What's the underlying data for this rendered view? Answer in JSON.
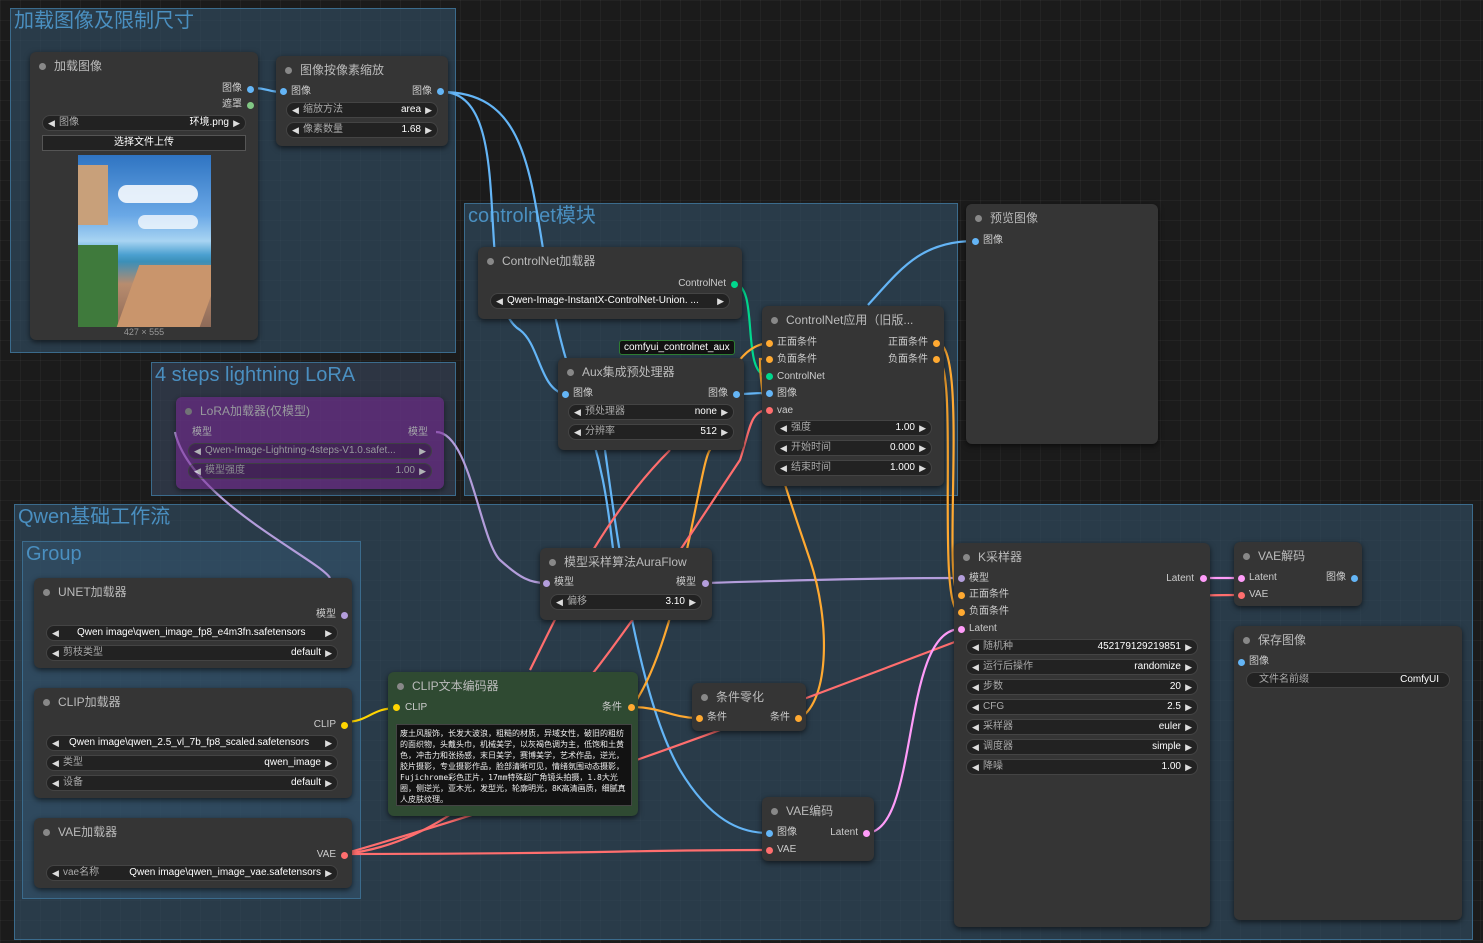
{
  "groups": {
    "load": "加载图像及限制尺寸",
    "controlnet": "controlnet模块",
    "lora": "4 steps lightning LoRA",
    "qwen": "Qwen基础工作流",
    "group": "Group"
  },
  "load_image": {
    "title": "加载图像",
    "out_image": "图像",
    "out_mask": "遮罩",
    "image_label": "图像",
    "image_value": "环境.png",
    "upload_button": "选择文件上传",
    "dimensions": "427 × 555"
  },
  "scale": {
    "title": "图像按像素缩放",
    "in_image": "图像",
    "out_image": "图像",
    "method_label": "缩放方法",
    "method_value": "area",
    "mp_label": "像素数量",
    "mp_value": "1.68"
  },
  "preview": {
    "title": "预览图像",
    "in_image": "图像"
  },
  "cn_loader": {
    "title": "ControlNet加载器",
    "out": "ControlNet",
    "model": "Qwen-Image-InstantX-ControlNet-Union. ..."
  },
  "cn_apply": {
    "title": "ControlNet应用（旧版...",
    "in_pos": "正面条件",
    "in_neg": "负面条件",
    "in_cn": "ControlNet",
    "in_image": "图像",
    "in_vae": "vae",
    "out_pos": "正面条件",
    "out_neg": "负面条件",
    "strength_label": "强度",
    "strength_value": "1.00",
    "start_label": "开始时间",
    "start_value": "0.000",
    "end_label": "结束时间",
    "end_value": "1.000"
  },
  "aux_tag": "comfyui_controlnet_aux",
  "aux": {
    "title": "Aux集成预处理器",
    "in_image": "图像",
    "out_image": "图像",
    "pre_label": "预处理器",
    "pre_value": "none",
    "res_label": "分辨率",
    "res_value": "512"
  },
  "lora": {
    "title": "LoRA加载器(仅模型)",
    "in_model": "模型",
    "out_model": "模型",
    "name": "Qwen-Image-Lightning-4steps-V1.0.safet...",
    "strength_label": "模型强度",
    "strength_value": "1.00"
  },
  "unet": {
    "title": "UNET加载器",
    "out": "模型",
    "name": "Qwen image\\qwen_image_fp8_e4m3fn.safetensors",
    "dtype_label": "剪枝类型",
    "dtype_value": "default"
  },
  "clip_loader": {
    "title": "CLIP加载器",
    "out": "CLIP",
    "name": "Qwen image\\qwen_2.5_vl_7b_fp8_scaled.safetensors",
    "type_label": "类型",
    "type_value": "qwen_image",
    "device_label": "设备",
    "device_value": "default"
  },
  "vae_loader": {
    "title": "VAE加载器",
    "out": "VAE",
    "name_label": "vae名称",
    "name_value": "Qwen image\\qwen_image_vae.safetensors"
  },
  "aura": {
    "title": "模型采样算法AuraFlow",
    "in_model": "模型",
    "out_model": "模型",
    "shift_label": "偏移",
    "shift_value": "3.10"
  },
  "clip_text": {
    "title": "CLIP文本编码器",
    "in_clip": "CLIP",
    "out_cond": "条件",
    "prompt": "废土风服饰，长发大波浪，粗糙的材质，异域女性，破旧的粗纺的面织物，头戴头巾，机械美学，以灰褐色调为主，低饱和土黄色，冲击力和张扬感，末日美学，赛博美学，艺术作品，逆光，胶片摄影，专业摄影作品，脸部清晰可见，情绪氛围动态摄影，Fujichrome彩色正片，17mm特殊超广角镜头拍摄，1.8大光圈，侧逆光，亚木光，发型光，轮廓明光，8K高清画质，细腻真人皮肤纹理。"
  },
  "zero": {
    "title": "条件零化",
    "in": "条件",
    "out": "条件"
  },
  "vae_encode": {
    "title": "VAE编码",
    "in_image": "图像",
    "in_vae": "VAE",
    "out": "Latent"
  },
  "ksampler": {
    "title": "K采样器",
    "in_model": "模型",
    "in_pos": "正面条件",
    "in_neg": "负面条件",
    "in_latent": "Latent",
    "out": "Latent",
    "seed_label": "随机种",
    "seed_value": "452179129219851",
    "after_label": "运行后操作",
    "after_value": "randomize",
    "steps_label": "步数",
    "steps_value": "20",
    "cfg_label": "CFG",
    "cfg_value": "2.5",
    "sampler_label": "采样器",
    "sampler_value": "euler",
    "sched_label": "调度器",
    "sched_value": "simple",
    "denoise_label": "降噪",
    "denoise_value": "1.00"
  },
  "vae_decode": {
    "title": "VAE解码",
    "in_latent": "Latent",
    "in_vae": "VAE",
    "out": "图像"
  },
  "save": {
    "title": "保存图像",
    "in_image": "图像",
    "prefix_label": "文件名前缀",
    "prefix_value": "ComfyUI"
  },
  "colors": {
    "image": "#64b5f6",
    "mask": "#81c784",
    "model": "#b39ddb",
    "clip": "#ffd500",
    "cond": "#ffa931",
    "vae": "#ff6e6e",
    "latent": "#ff9cf9",
    "controlnet": "#00d78d"
  }
}
